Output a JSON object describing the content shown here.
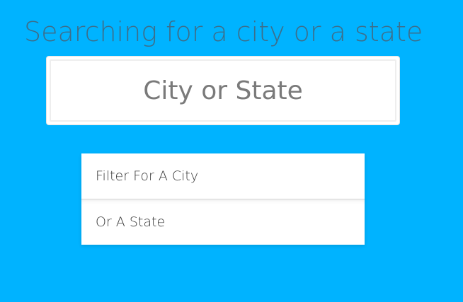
{
  "page": {
    "title": "Searching for a city or a state",
    "background_color": "#00b3ff"
  },
  "search": {
    "placeholder": "City or State",
    "value": ""
  },
  "suggestions": {
    "items": [
      {
        "label": "Filter For A City"
      },
      {
        "label": "Or A State"
      }
    ]
  }
}
